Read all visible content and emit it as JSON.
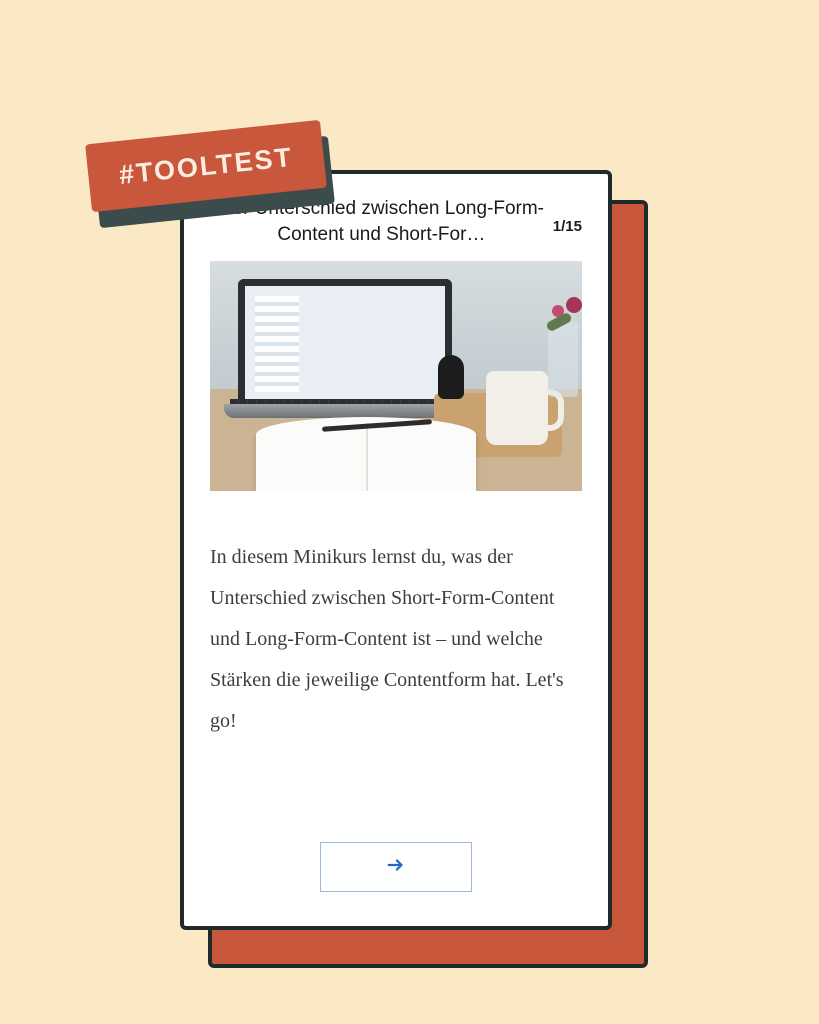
{
  "tag": {
    "label": "#TOOLTEST"
  },
  "lesson": {
    "title": "Der Unterschied zwischen Long-Form-Content und Short-For…",
    "counter": "1/15",
    "body": "In diesem Minikurs lernst du, was der Unterschied zwischen Short-Form-Content und Long-Form-Content ist – und welche Stärken die jeweilige Contentform hat. Let's go!"
  },
  "icons": {
    "next": "arrow-right"
  }
}
